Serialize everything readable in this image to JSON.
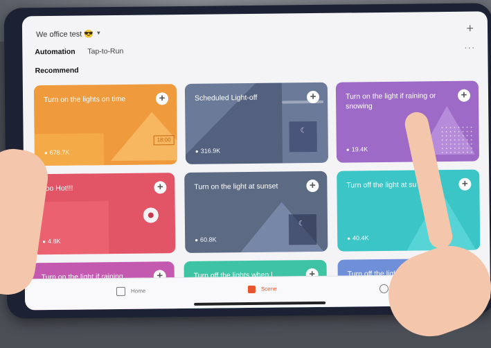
{
  "header": {
    "home_name": "We office test 😎",
    "caret": "▾",
    "add_icon": "plus-icon",
    "more_icon": "more-icon"
  },
  "tabs": [
    {
      "label": "Automation",
      "active": true
    },
    {
      "label": "Tap-to-Run",
      "active": false
    }
  ],
  "section_title": "Recommend",
  "cards": [
    {
      "title": "Turn on the lights on time",
      "count": "678.7K",
      "color": "#ef9a3c",
      "extra": "18:00"
    },
    {
      "title": "Scheduled Light-off",
      "count": "316.9K",
      "color": "#6a7a98"
    },
    {
      "title": "Turn on the light if raining or snowing",
      "count": "19.4K",
      "color": "#9d6bc7"
    },
    {
      "title": "Too Hot!!!",
      "count": "4.8K",
      "color": "#e25566"
    },
    {
      "title": "Turn on the light at sunset",
      "count": "60.8K",
      "color": "#5c6a84"
    },
    {
      "title": "Turn off the light at su",
      "count": "40.4K",
      "color": "#3cc5c6"
    },
    {
      "title": "Turn on the light if raining",
      "count": "",
      "color": "#c35ab0"
    },
    {
      "title": "Turn off the lights when l",
      "count": "",
      "color": "#3fc3a5"
    },
    {
      "title": "Turn off the light at su",
      "count": "",
      "color": "#6f8fd8"
    }
  ],
  "bottom_nav": [
    {
      "label": "Home",
      "icon": "home-icon",
      "active": false
    },
    {
      "label": "Scene",
      "icon": "scene-icon",
      "active": true
    },
    {
      "label": "Me",
      "icon": "me-icon",
      "active": false
    }
  ]
}
